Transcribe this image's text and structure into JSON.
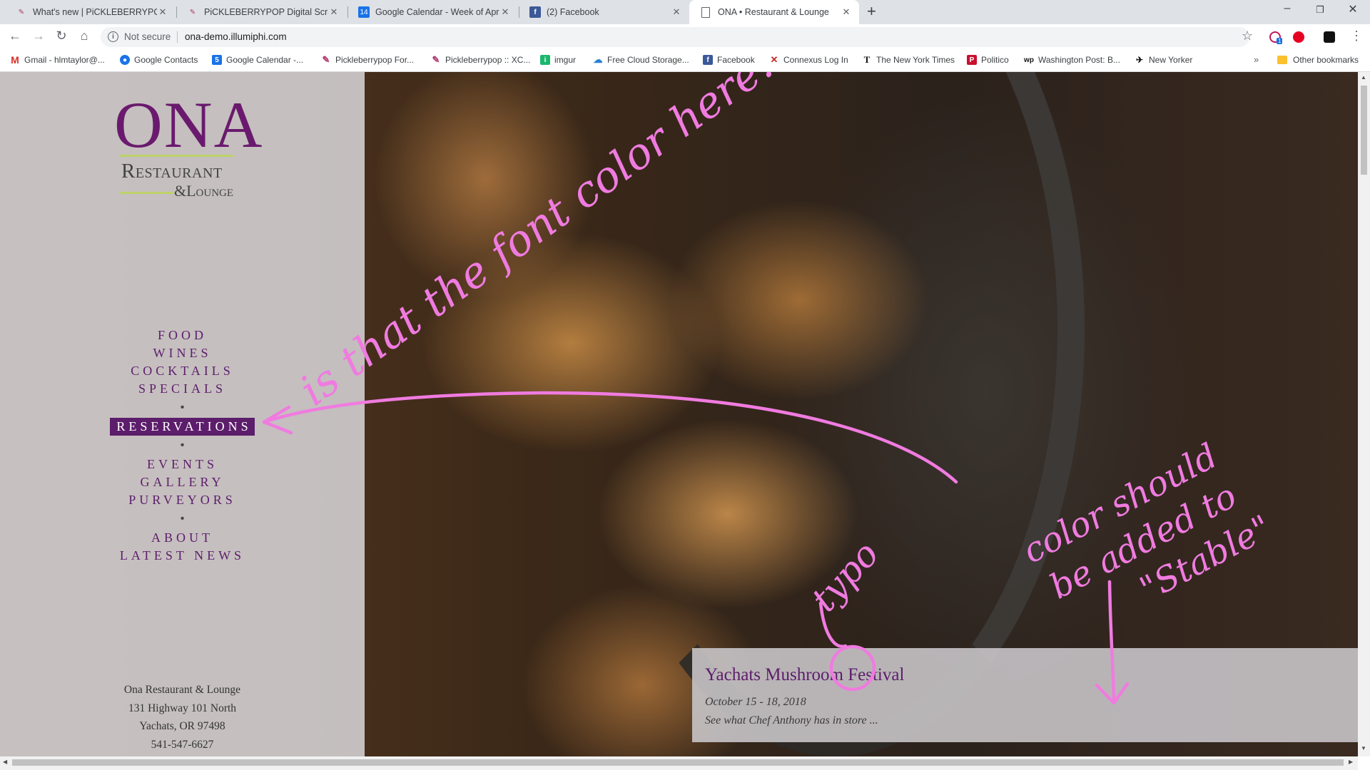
{
  "tabs": [
    {
      "label": "What's new | PiCKLEBERRYPOP F",
      "icon": "pickleberrypop-icon"
    },
    {
      "label": "PiCKLEBERRYPOP Digital Scrapbc",
      "icon": "pickleberrypop-icon"
    },
    {
      "label": "Google Calendar - Week of April",
      "icon": "google-calendar-icon",
      "icon_text": "14"
    },
    {
      "label": "(2) Facebook",
      "icon": "facebook-icon",
      "icon_text": "f"
    },
    {
      "label": "ONA • Restaurant & Lounge",
      "icon": "page-icon",
      "active": true
    }
  ],
  "toolbar": {
    "security": "Not secure",
    "url": "ona-demo.illumiphi.com",
    "ext_badge": "1"
  },
  "bookmarks": [
    {
      "label": "Gmail - hlmtaylor@...",
      "icon": "gmail-icon",
      "color": "#d93025",
      "glyph": "M"
    },
    {
      "label": "Google Contacts",
      "icon": "contacts-icon",
      "color": "#1a73e8",
      "glyph": "●"
    },
    {
      "label": "Google Calendar -...",
      "icon": "calendar-icon",
      "color": "#1a73e8",
      "glyph": "5"
    },
    {
      "label": "Pickleberrypop For...",
      "icon": "pickleberrypop-icon",
      "color": "#b0386e",
      "glyph": "✎"
    },
    {
      "label": "Pickleberrypop :: XC...",
      "icon": "pickleberrypop-icon",
      "color": "#b0386e",
      "glyph": "✎"
    },
    {
      "label": "imgur",
      "icon": "imgur-icon",
      "color": "#1bb76e",
      "glyph": "i"
    },
    {
      "label": "Free Cloud Storage...",
      "icon": "cloud-icon",
      "color": "#2a7fd4",
      "glyph": "☁"
    },
    {
      "label": "Facebook",
      "icon": "facebook-icon",
      "color": "#3b5998",
      "glyph": "f"
    },
    {
      "label": "Connexus Log In",
      "icon": "connexus-icon",
      "color": "#c62828",
      "glyph": "✕"
    },
    {
      "label": "The New York Times",
      "icon": "nyt-icon",
      "color": "#111111",
      "glyph": "T"
    },
    {
      "label": "Politico",
      "icon": "politico-icon",
      "color": "#c8102e",
      "glyph": "P"
    },
    {
      "label": "Washington Post: B...",
      "icon": "wapo-icon",
      "color": "#111111",
      "glyph": "wp"
    },
    {
      "label": "New Yorker",
      "icon": "new-yorker-icon",
      "color": "#111111",
      "glyph": "✈"
    }
  ],
  "other_bookmarks": "Other bookmarks",
  "site": {
    "logo": {
      "ona": "ONA",
      "restaurant": "Restaurant",
      "lounge": "&Lounge"
    },
    "nav_groups": [
      [
        "FOOD",
        "WINES",
        "COCKTAILS",
        "SPECIALS"
      ],
      [
        "RESERVATIONS"
      ],
      [
        "EVENTS",
        "GALLERY",
        "PURVEYORS"
      ],
      [
        "ABOUT",
        "LATEST NEWS"
      ]
    ],
    "nav_separator": "•",
    "address": [
      "Ona Restaurant & Lounge",
      "131 Highway 101 North",
      "Yachats, OR 97498",
      "541-547-6627"
    ],
    "promo": {
      "title": "Yachats Mushroom Festival",
      "date": "October 15 - 18, 2018",
      "subtitle": "See what Chef Anthony has in store ..."
    }
  },
  "annotations": {
    "note1": "is that the font color here?",
    "note2": "color should be added to \"Stable\"",
    "note3": "typo",
    "color": "#f07be0"
  },
  "colors": {
    "brand_purple": "#5c1d6b",
    "logo_green": "#bdd26a"
  }
}
